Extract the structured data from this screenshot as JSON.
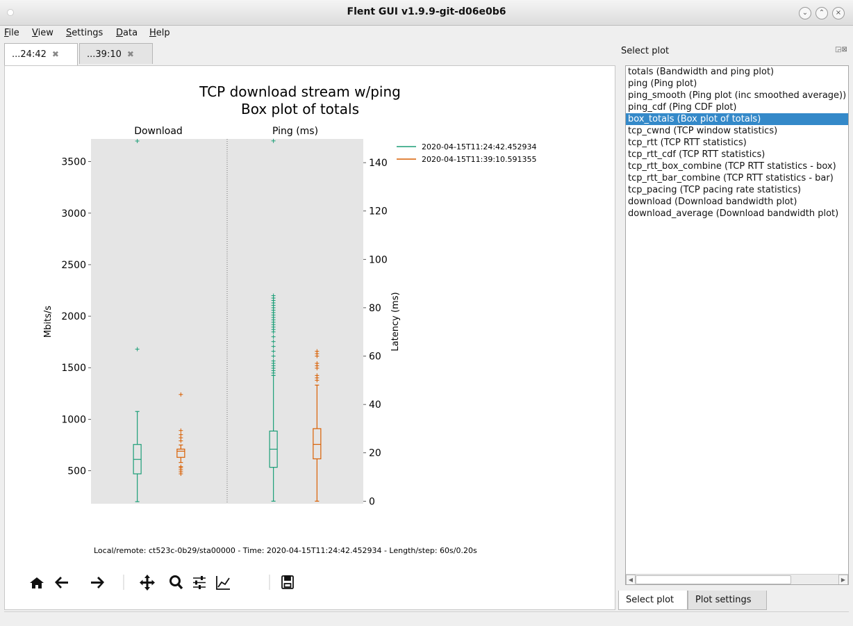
{
  "window": {
    "title": "Flent GUI v1.9.9-git-d06e0b6"
  },
  "menu": [
    {
      "label": "File",
      "u": "F",
      "rest": "ile"
    },
    {
      "label": "View",
      "u": "V",
      "rest": "iew"
    },
    {
      "label": "Settings",
      "u": "S",
      "rest": "ettings"
    },
    {
      "label": "Data",
      "u": "D",
      "rest": "ata"
    },
    {
      "label": "Help",
      "u": "H",
      "rest": "elp"
    }
  ],
  "tabs": [
    {
      "label": "...24:42"
    },
    {
      "label": "...39:10"
    }
  ],
  "plot": {
    "title_line1": "TCP download stream w/ping",
    "title_line2": "Box plot of totals",
    "subplot_left": "Download",
    "subplot_right": "Ping (ms)",
    "ylabel_left": "Mbits/s",
    "ylabel_right": "Latency (ms)",
    "footer": "Local/remote: ct523c-0b29/sta00000 - Time: 2020-04-15T11:24:42.452934 - Length/step: 60s/0.20s"
  },
  "chart_data": {
    "type": "box",
    "title": "TCP download stream w/ping\nBox plot of totals",
    "colors": {
      "series1": "#1b9e77",
      "series2": "#d95f02",
      "bg": "#e5e5e5"
    },
    "series": [
      {
        "name": "2020-04-15T11:24:42.452934",
        "color": "#1b9e77"
      },
      {
        "name": "2020-04-15T11:39:10.591355",
        "color": "#d95f02"
      }
    ],
    "panels": [
      {
        "name": "Download",
        "axis": "left",
        "ylabel": "Mbits/s",
        "ylim": [
          180,
          3720
        ],
        "yticks": [
          500,
          1000,
          1500,
          2000,
          2500,
          3000,
          3500
        ],
        "boxes": [
          {
            "series": 0,
            "whislo": 200,
            "q1": 470,
            "median": 610,
            "q3": 755,
            "whishi": 1075,
            "fliers": [
              1680,
              3700
            ]
          },
          {
            "series": 1,
            "whislo": 580,
            "q1": 630,
            "median": 690,
            "q3": 710,
            "whishi": 750,
            "fliers": [
              470,
              490,
              510,
              530,
              540,
              790,
              820,
              850,
              890,
              1240
            ]
          }
        ]
      },
      {
        "name": "Ping (ms)",
        "axis": "right",
        "ylabel": "Latency (ms)",
        "ylim": [
          -1.05,
          149.8
        ],
        "yticks": [
          0,
          20,
          40,
          60,
          80,
          100,
          120,
          140
        ],
        "boxes": [
          {
            "series": 0,
            "whislo": 0,
            "q1": 14,
            "median": 21.5,
            "q3": 29,
            "whishi": 52,
            "fliers": [
              53,
              54,
              55,
              56,
              57,
              58,
              60,
              62,
              64,
              66,
              68,
              70,
              71,
              72,
              73,
              74,
              75,
              76,
              77,
              78,
              79,
              80,
              81,
              82,
              83,
              84,
              85,
              149
            ]
          },
          {
            "series": 1,
            "whislo": 0,
            "q1": 17.5,
            "median": 23.5,
            "q3": 30,
            "whishi": 48,
            "fliers": [
              50,
              51,
              52,
              55,
              56,
              57,
              60,
              61,
              62
            ]
          }
        ]
      }
    ]
  },
  "sidebar": {
    "title": "Select plot",
    "title_u_index": 5,
    "items": [
      {
        "label": "totals (Bandwidth and ping plot)"
      },
      {
        "label": "ping (Ping plot)"
      },
      {
        "label": "ping_smooth (Ping plot (inc smoothed average))"
      },
      {
        "label": "ping_cdf (Ping CDF plot)"
      },
      {
        "label": "box_totals (Box plot of totals)",
        "selected": true
      },
      {
        "label": "tcp_cwnd (TCP window statistics)"
      },
      {
        "label": "tcp_rtt (TCP RTT statistics)"
      },
      {
        "label": "tcp_rtt_cdf (TCP RTT statistics)"
      },
      {
        "label": "tcp_rtt_box_combine (TCP RTT statistics - box)"
      },
      {
        "label": "tcp_rtt_bar_combine (TCP RTT statistics - bar)"
      },
      {
        "label": "tcp_pacing (TCP pacing rate statistics)"
      },
      {
        "label": "download (Download bandwidth plot)"
      },
      {
        "label": "download_average (Download bandwidth plot)"
      }
    ]
  },
  "dock_tabs": [
    {
      "label": "Select plot"
    },
    {
      "label": "Plot settings"
    }
  ]
}
